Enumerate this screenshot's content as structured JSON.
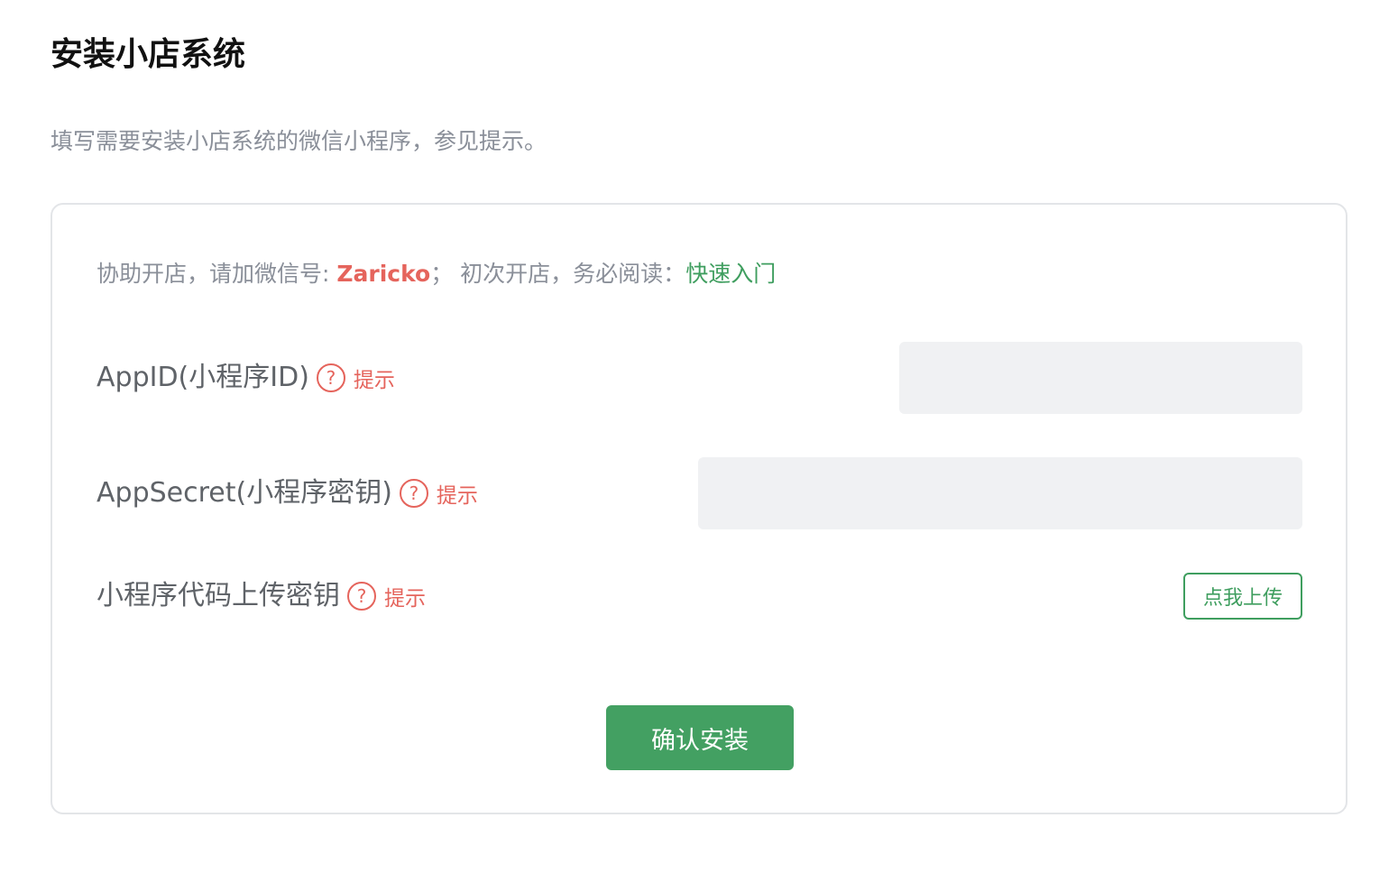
{
  "header": {
    "title": "安装小店系统",
    "description": "填写需要安装小店系统的微信小程序，参见提示。"
  },
  "notice": {
    "assist_prefix": "协助开店，请加微信号: ",
    "wechat_id": "Zaricko",
    "separator": "；  初次开店，务必阅读：",
    "quick_start_link": "快速入门"
  },
  "form": {
    "appid": {
      "label": "AppID(小程序ID)",
      "help_icon": "?",
      "hint": "提示",
      "value": "",
      "placeholder": ""
    },
    "appsecret": {
      "label": "AppSecret(小程序密钥)",
      "help_icon": "?",
      "hint": "提示",
      "value": "",
      "placeholder": ""
    },
    "upload_key": {
      "label": "小程序代码上传密钥",
      "help_icon": "?",
      "hint": "提示",
      "button_label": "点我上传"
    },
    "confirm_label": "确认安装"
  },
  "colors": {
    "accent_green": "#43a062",
    "hint_red": "#e5645c",
    "muted_text": "#8a8f99",
    "input_bg": "#f0f1f3"
  }
}
